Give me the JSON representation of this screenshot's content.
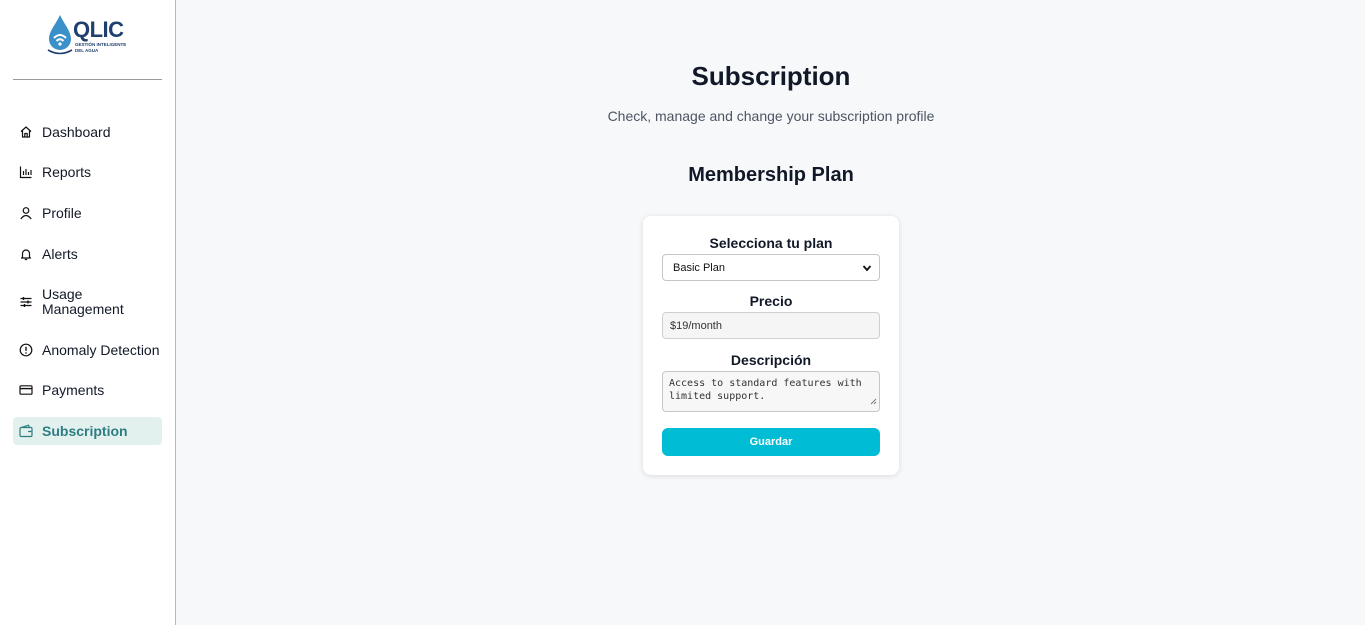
{
  "brand": {
    "name": "QLIC",
    "tagline": "GESTIÓN INTELIGENTE DEL AGUA",
    "colors": {
      "primary": "#1f3f6e",
      "drop": "#3a90c8"
    }
  },
  "sidebar": {
    "items": [
      {
        "label": "Dashboard",
        "icon": "home-icon",
        "active": false
      },
      {
        "label": "Reports",
        "icon": "bar-chart-icon",
        "active": false
      },
      {
        "label": "Profile",
        "icon": "user-icon",
        "active": false
      },
      {
        "label": "Alerts",
        "icon": "bell-icon",
        "active": false
      },
      {
        "label": "Usage Management",
        "icon": "sliders-icon",
        "active": false
      },
      {
        "label": "Anomaly Detection",
        "icon": "alert-circle-icon",
        "active": false
      },
      {
        "label": "Payments",
        "icon": "credit-card-icon",
        "active": false
      },
      {
        "label": "Subscription",
        "icon": "wallet-icon",
        "active": true
      }
    ],
    "active_color": "#2f7d84",
    "active_bg": "#e3f1ee"
  },
  "page": {
    "title": "Subscription",
    "subtitle": "Check, manage and change your subscription profile",
    "section_title": "Membership Plan"
  },
  "form": {
    "plan_label": "Selecciona tu plan",
    "plan_value": "Basic Plan",
    "price_label": "Precio",
    "price_value": "$19/month",
    "description_label": "Descripción",
    "description_value": "Access to standard features with limited support.",
    "save_label": "Guardar",
    "button_color": "#00bcd4"
  }
}
